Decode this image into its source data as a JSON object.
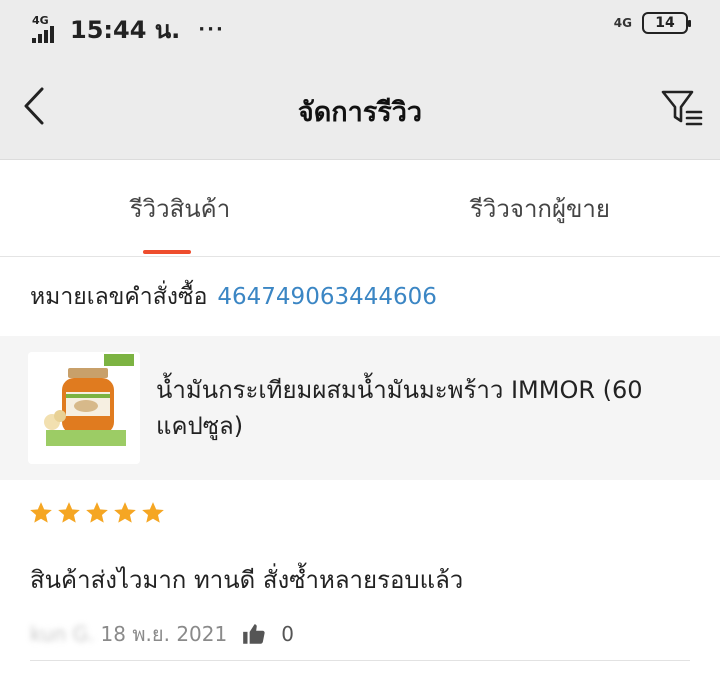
{
  "status_bar": {
    "network_left": "4G",
    "time": "15:44 น.",
    "dots": "···",
    "network_right": "4G",
    "battery": "14"
  },
  "header": {
    "title": "จัดการรีวิว",
    "back_icon": "chevron-left-icon",
    "filter_icon": "filter-icon"
  },
  "tabs": [
    {
      "label": "รีวิวสินค้า",
      "active": true
    },
    {
      "label": "รีวิวจากผู้ขาย",
      "active": false
    }
  ],
  "order": {
    "label": "หมายเลขคำสั่งซื้อ",
    "number": "464749063444606"
  },
  "product": {
    "name": "น้ำมันกระเทียมผสมน้ำมันมะพร้าว IMMOR (60 แคปซูล)",
    "thumbnail_icon": "product-bottle-image"
  },
  "review": {
    "rating": 5,
    "max_rating": 5,
    "text": "สินค้าส่งไวมาก ทานดี สั่งซ้ำหลายรอบแล้ว",
    "reviewer": "kun G.",
    "date": "18 พ.ย. 2021",
    "likes": "0"
  },
  "colors": {
    "accent": "#ee4d2d",
    "link": "#3b86c4",
    "star": "#f5a623",
    "header_bg": "#ececec"
  }
}
